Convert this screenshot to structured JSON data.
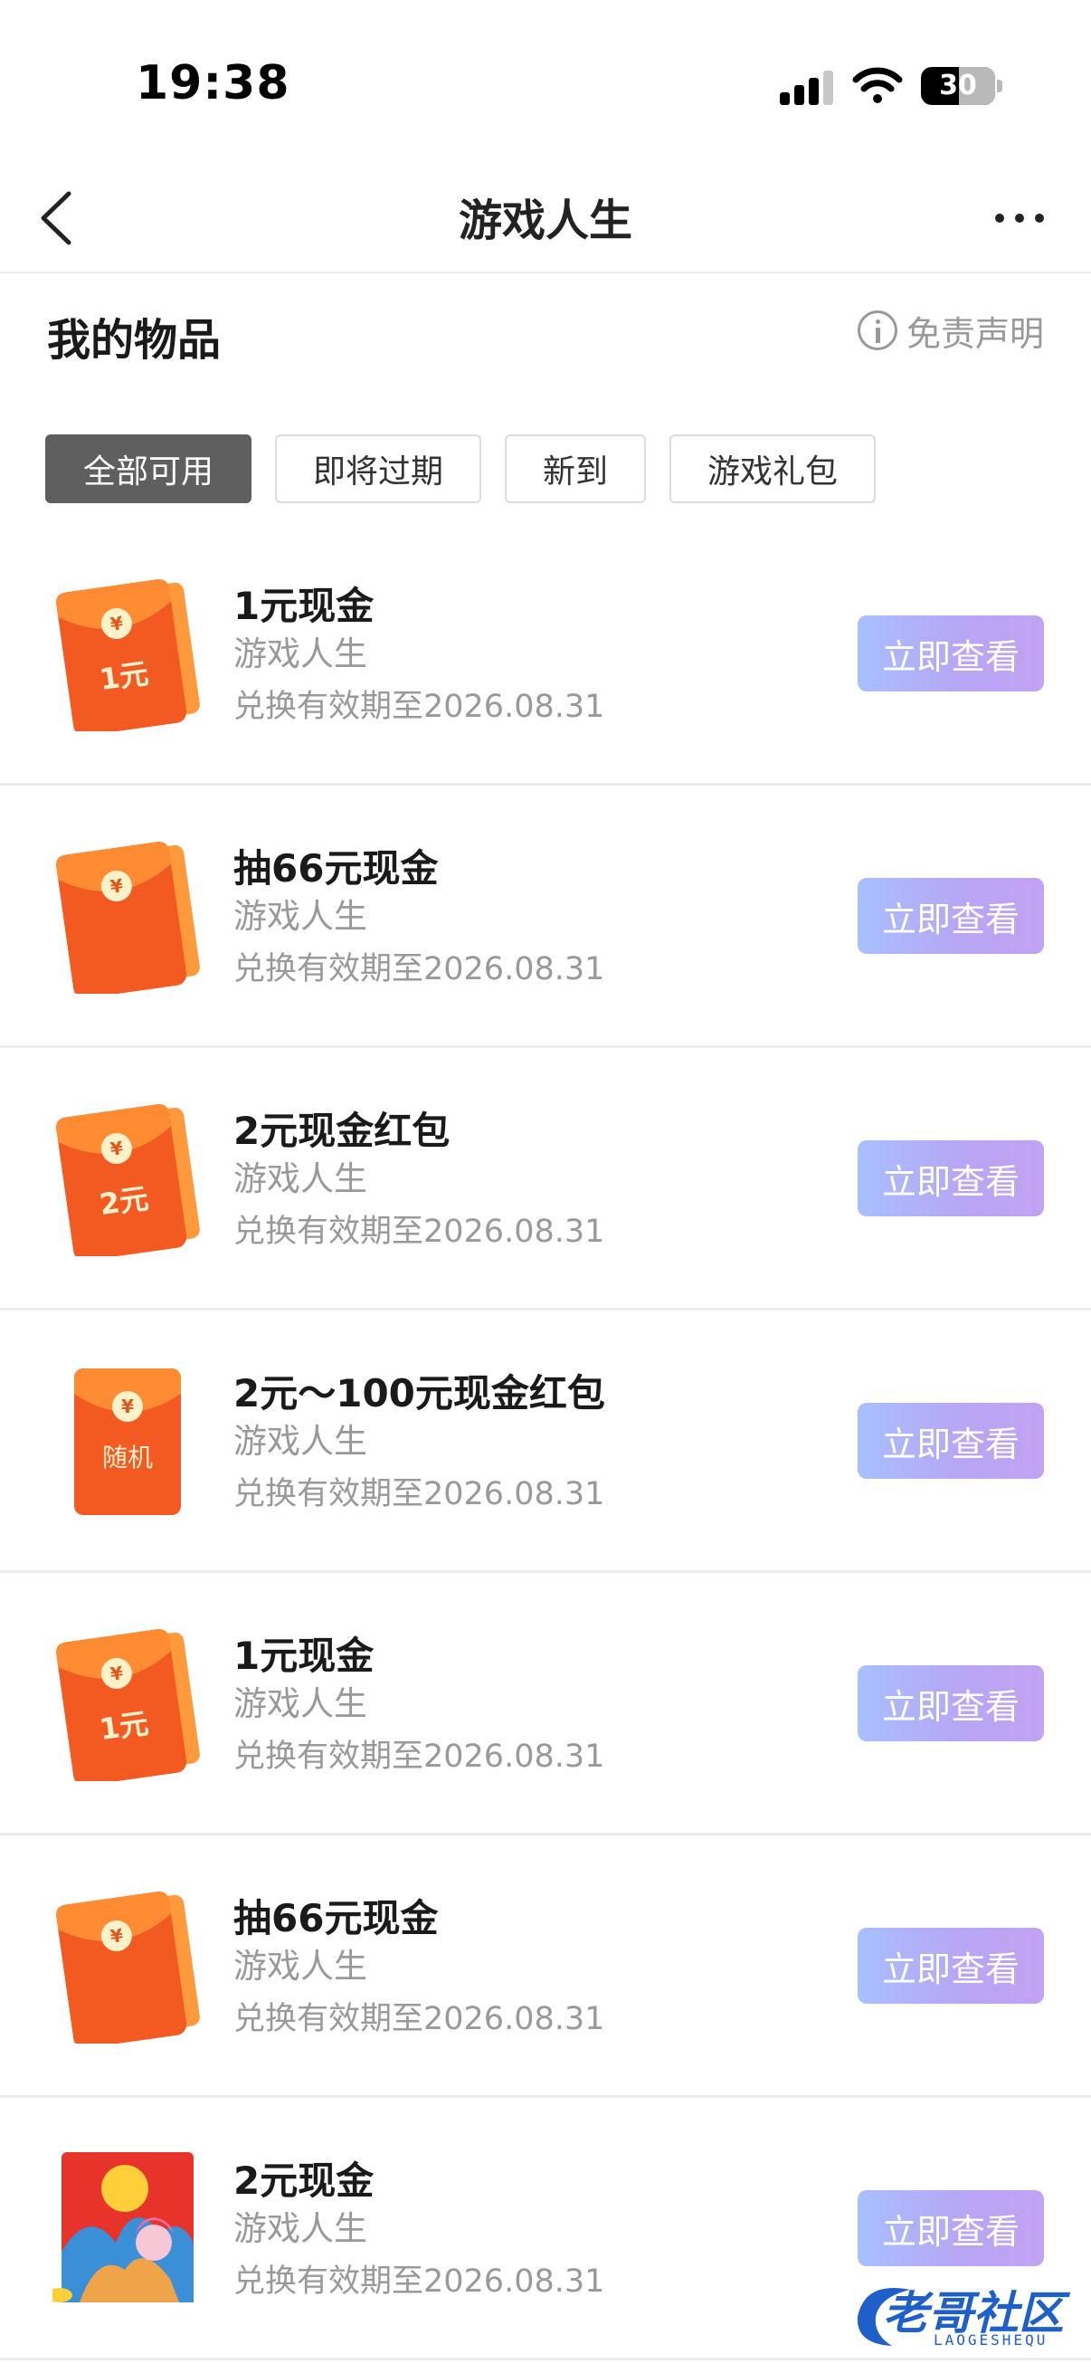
{
  "status_bar": {
    "time": "19:38",
    "battery": "30"
  },
  "nav": {
    "title": "游戏人生"
  },
  "header": {
    "title": "我的物品",
    "disclaimer": "免责声明"
  },
  "tabs": [
    {
      "label": "全部可用",
      "active": true
    },
    {
      "label": "即将过期",
      "active": false
    },
    {
      "label": "新到",
      "active": false
    },
    {
      "label": "游戏礼包",
      "active": false
    }
  ],
  "items": [
    {
      "title": "1元现金",
      "subtitle": "游戏人生",
      "expiry": "兑换有效期至2026.08.31",
      "icon": "red-envelope-icon",
      "icon_label": "1元",
      "button": "立即查看"
    },
    {
      "title": "抽66元现金",
      "subtitle": "游戏人生",
      "expiry": "兑换有效期至2026.08.31",
      "icon": "red-envelope-icon",
      "icon_label": "",
      "button": "立即查看"
    },
    {
      "title": "2元现金红包",
      "subtitle": "游戏人生",
      "expiry": "兑换有效期至2026.08.31",
      "icon": "red-envelope-icon",
      "icon_label": "2元",
      "button": "立即查看"
    },
    {
      "title": "2元～100元现金红包",
      "subtitle": "游戏人生",
      "expiry": "兑换有效期至2026.08.31",
      "icon": "random-red-envelope-icon",
      "icon_label": "随机",
      "button": "立即查看"
    },
    {
      "title": "1元现金",
      "subtitle": "游戏人生",
      "expiry": "兑换有效期至2026.08.31",
      "icon": "red-envelope-icon",
      "icon_label": "1元",
      "button": "立即查看"
    },
    {
      "title": "抽66元现金",
      "subtitle": "游戏人生",
      "expiry": "兑换有效期至2026.08.31",
      "icon": "red-envelope-icon",
      "icon_label": "",
      "button": "立即查看"
    },
    {
      "title": "2元现金",
      "subtitle": "游戏人生",
      "expiry": "兑换有效期至2026.08.31",
      "icon": "illustrated-red-envelope-icon",
      "icon_label": "",
      "button": "立即查看"
    }
  ],
  "watermark": {
    "text": "老哥社区",
    "sub": "LAOGESHEQU"
  },
  "colors": {
    "envelope_orange": "#ff7a1e",
    "envelope_red": "#f04a22",
    "button_start": "#a8c0ff",
    "button_end": "#c2a2f2",
    "active_tab": "#5f5f5f"
  }
}
